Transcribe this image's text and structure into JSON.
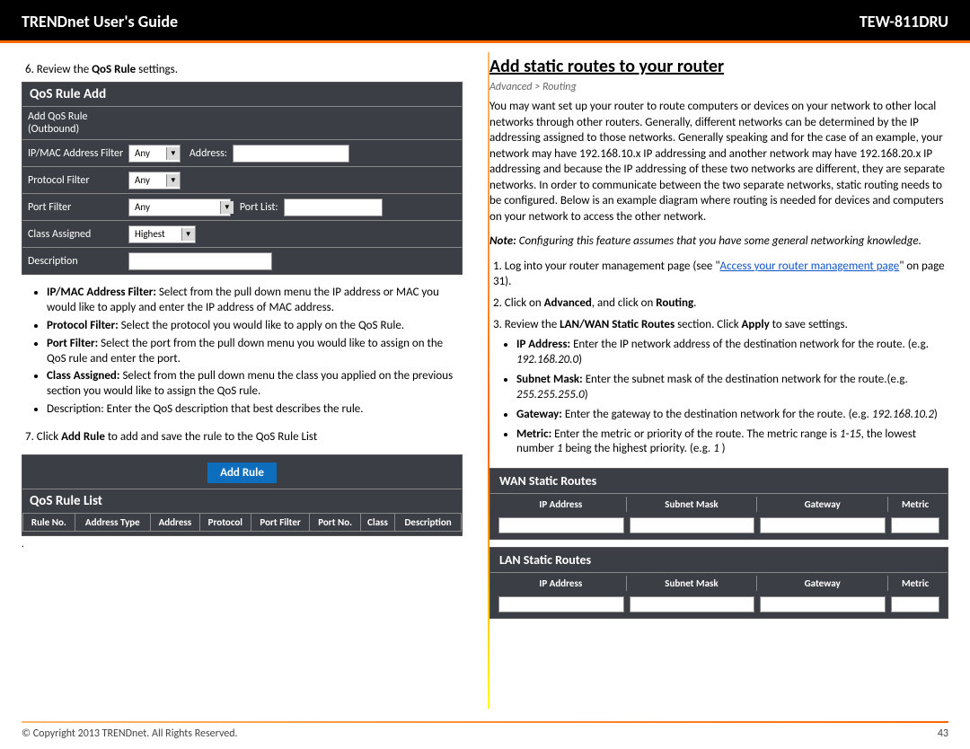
{
  "header": {
    "guide_title": "TRENDnet User's Guide",
    "model": "TEW-811DRU"
  },
  "left": {
    "step6": "6. Review the ",
    "step6b": "QoS Rule",
    "step6c": " settings.",
    "qos_add": {
      "title": "QoS Rule Add",
      "r1_label": "Add QoS Rule (Outbound)",
      "r2_label": "IP/MAC Address Filter",
      "r2_sel": "Any",
      "r2_inner": "Address:",
      "r3_label": "Protocol Filter",
      "r3_sel": "Any",
      "r4_label": "Port Filter",
      "r4_sel": "Any",
      "r4_inner": "Port List:",
      "r5_label": "Class Assigned",
      "r5_sel": "Highest",
      "r6_label": "Description"
    },
    "bullets": {
      "b1a": "IP/MAC Address Filter:",
      "b1b": " Select from the pull down menu the IP address or MAC you would like to apply and enter the IP address of MAC address.",
      "b2a": "Protocol Filter:",
      "b2b": " Select the protocol you would like to apply on the QoS Rule.",
      "b3a": "Port Filter:",
      "b3b": " Select the port from the pull down menu you would like to assign on the QoS rule and enter the port.",
      "b4a": "Class Assigned:",
      "b4b": " Select from the pull down menu the class you applied on the previous section you would like to assign the QoS rule.",
      "b5": "Description: Enter the QoS description that best describes the rule."
    },
    "step7a": "7. Click ",
    "step7b": "Add Rule",
    "step7c": " to add and save the rule to the QoS Rule List",
    "add_rule_btn": "Add Rule",
    "list_title": "QoS Rule List",
    "list_cols": [
      "Rule No.",
      "Address Type",
      "Address",
      "Protocol",
      "Port Filter",
      "Port No.",
      "Class",
      "Description"
    ]
  },
  "right": {
    "title": "Add static routes to your router",
    "crumb": "Advanced > Routing",
    "para": "You may want set up your router to route computers or devices on your network to other local networks through other routers. Generally, different networks can be determined by the IP addressing assigned to those networks. Generally speaking and for the case of an example, your network may have 192.168.10.x IP addressing and another network may have 192.168.20.x IP addressing and because the IP addressing of these two networks are different, they are separate networks. In order to communicate between the two separate networks, static routing needs to be configured. Below is an example diagram where routing is needed for devices and computers on your network to access the other network.",
    "note_a": "Note:",
    "note_b": " Configuring this feature assumes that you have some general networking knowledge.",
    "s1a": "1. Log into your router management page (see \"",
    "s1link": "Access your router management page",
    "s1b": "\" on page 31).",
    "s2a": "2. Click on ",
    "s2b": "Advanced",
    "s2c": ", and click on ",
    "s2d": "Routing",
    "s2e": ".",
    "s3a": "3. Review the ",
    "s3b": "LAN/WAN Static Routes",
    "s3c": " section. Click ",
    "s3d": "Apply",
    "s3e": " to save settings.",
    "sub": {
      "ip_a": "IP Address:",
      "ip_b": " Enter the IP network address of the destination network for the route. (e.g. ",
      "ip_c": "192.168.20.0",
      "ip_d": ")",
      "sm_a": "Subnet Mask:",
      "sm_b": " Enter the subnet mask of the destination network for the route.(e.g. ",
      "sm_c": "255.255.255.0",
      "sm_d": ")",
      "gw_a": "Gateway:",
      "gw_b": " Enter the gateway to the destination network for the route. (e.g. ",
      "gw_c": "192.168.10.2",
      "gw_d": ")",
      "me_a": "Metric:",
      "me_b": " Enter the metric or priority of the route. The metric range is ",
      "me_c": "1-15",
      "me_d": ", the lowest number ",
      "me_e": "1",
      "me_f": " being the highest priority. (e.g. ",
      "me_g": "1",
      "me_h": " )"
    },
    "wan_title": "WAN Static Routes",
    "lan_title": "LAN Static Routes",
    "route_cols": [
      "IP Address",
      "Subnet Mask",
      "Gateway",
      "Metric"
    ]
  },
  "footer": {
    "copyright": "© Copyright 2013 TRENDnet. All Rights Reserved.",
    "page": "43"
  }
}
